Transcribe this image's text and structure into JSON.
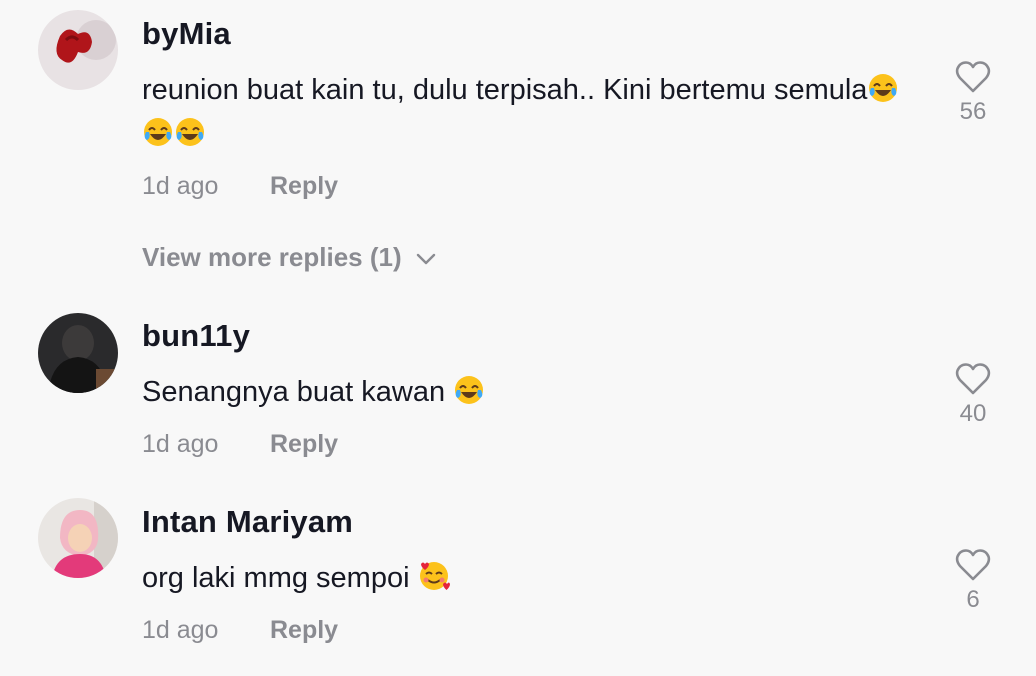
{
  "comments": [
    {
      "username": "byMia",
      "text": "reunion buat kain tu, dulu terpisah.. Kini bertemu semula",
      "emoji": [
        "face-with-tears-of-joy",
        "face-with-tears-of-joy",
        "face-with-tears-of-joy"
      ],
      "time": "1d ago",
      "reply": "Reply",
      "likes": "56",
      "view_more": "View more replies (1)"
    },
    {
      "username": "bun11y",
      "text": "Senangnya buat kawan ",
      "emoji": [
        "face-with-tears-of-joy"
      ],
      "time": "1d ago",
      "reply": "Reply",
      "likes": "40"
    },
    {
      "username": "Intan Mariyam",
      "text": "org laki mmg sempoi ",
      "emoji": [
        "smiling-face-with-hearts"
      ],
      "time": "1d ago",
      "reply": "Reply",
      "likes": "6"
    }
  ],
  "colors": {
    "background": "#f8f8f8",
    "username": "#161823",
    "meta": "#8a8b91"
  },
  "icons": {
    "like": "heart-outline-icon",
    "expand": "chevron-down-icon"
  }
}
